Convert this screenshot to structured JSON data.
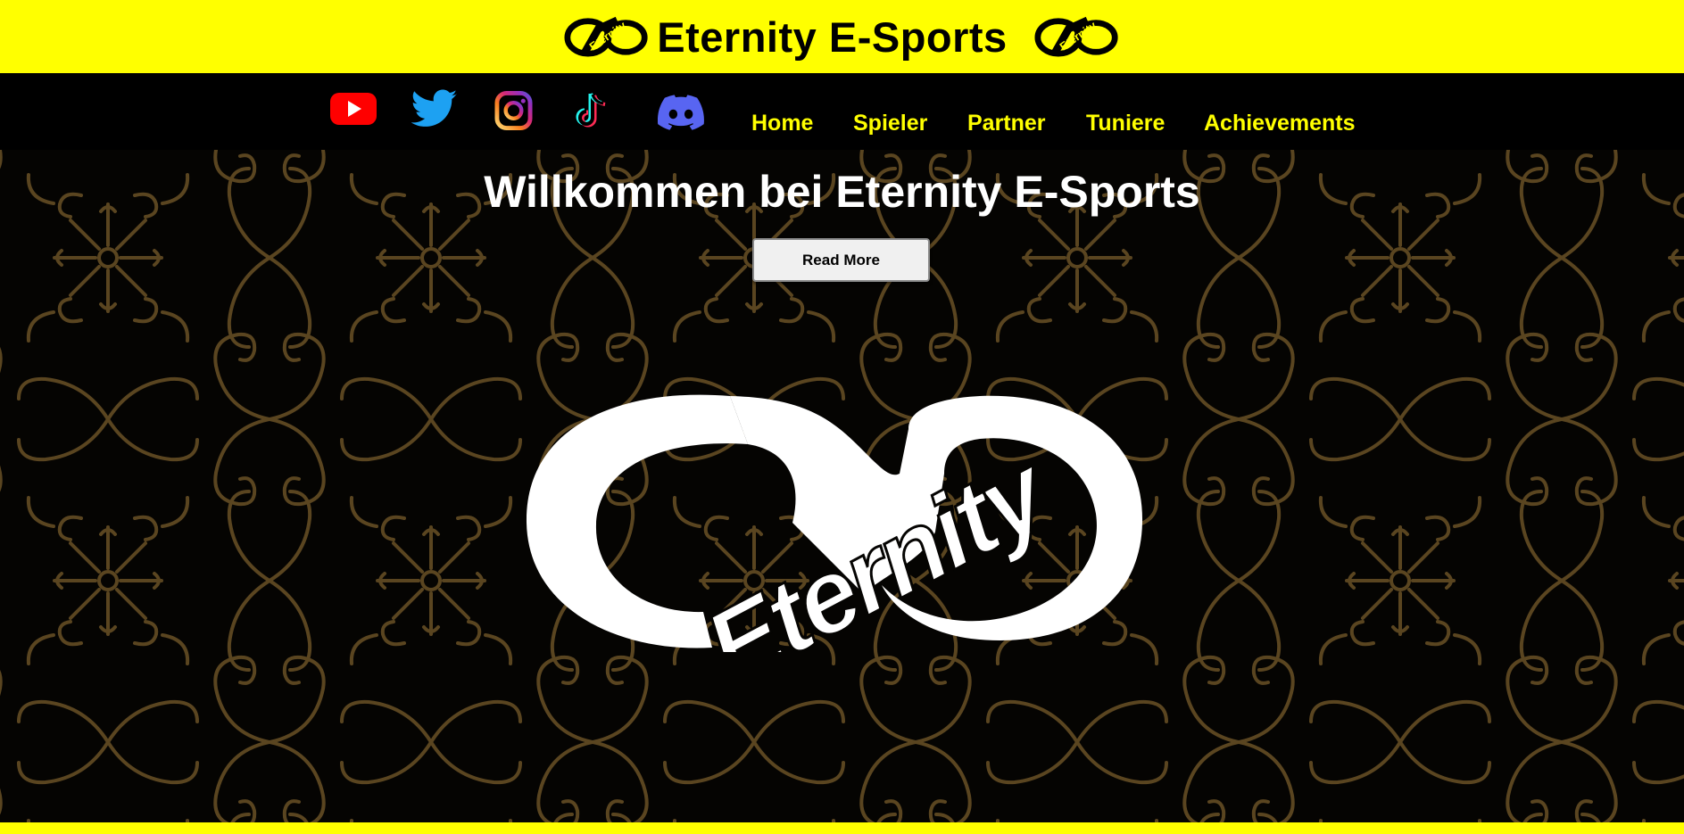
{
  "header": {
    "title": "Eternity E-Sports",
    "logo_icon": "eternity-infinity-logo",
    "background_color": "#ffff00"
  },
  "socials": [
    {
      "name": "youtube-icon",
      "color": "#ff0000"
    },
    {
      "name": "twitter-icon",
      "color": "#1da1f2"
    },
    {
      "name": "instagram-icon",
      "color": "#c13584"
    },
    {
      "name": "tiktok-icon",
      "color": "#000000"
    },
    {
      "name": "discord-icon",
      "color": "#5865f2"
    }
  ],
  "nav": {
    "items": [
      "Home",
      "Spieler",
      "Partner",
      "Tuniere",
      "Achievements"
    ],
    "link_color": "#ffff00"
  },
  "hero": {
    "title": "Willkommen bei Eternity E-Sports",
    "button_label": "Read More",
    "logo_icon": "eternity-infinity-logo",
    "pattern_color": "#5a4520"
  }
}
